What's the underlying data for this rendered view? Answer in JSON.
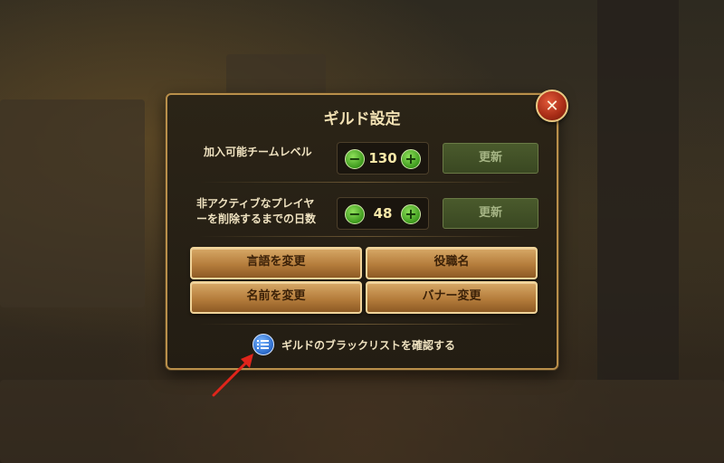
{
  "dialog": {
    "title": "ギルド設定",
    "close_icon": "close-x-icon"
  },
  "settings": {
    "join_level": {
      "label": "加入可能チームレベル",
      "value": "130",
      "minus_icon": "minus-icon",
      "plus_icon": "plus-icon",
      "update_label": "更新"
    },
    "inactive_days": {
      "label_line1": "非アクティブなプレイヤ",
      "label_line2": "ーを削除するまでの日数",
      "value": "48",
      "minus_icon": "minus-icon",
      "plus_icon": "plus-icon",
      "update_label": "更新"
    }
  },
  "buttons": {
    "change_language": "言語を変更",
    "role_names": "役職名",
    "change_name": "名前を変更",
    "change_banner": "バナー変更"
  },
  "blacklist": {
    "label": "ギルドのブラックリストを確認する",
    "icon": "list-icon"
  },
  "colors": {
    "accent_gold": "#b98f4a",
    "update_disabled": "#3a4822",
    "step_green": "#3d9a1d",
    "close_red": "#a62b15",
    "annotation_arrow": "#e0251b"
  }
}
